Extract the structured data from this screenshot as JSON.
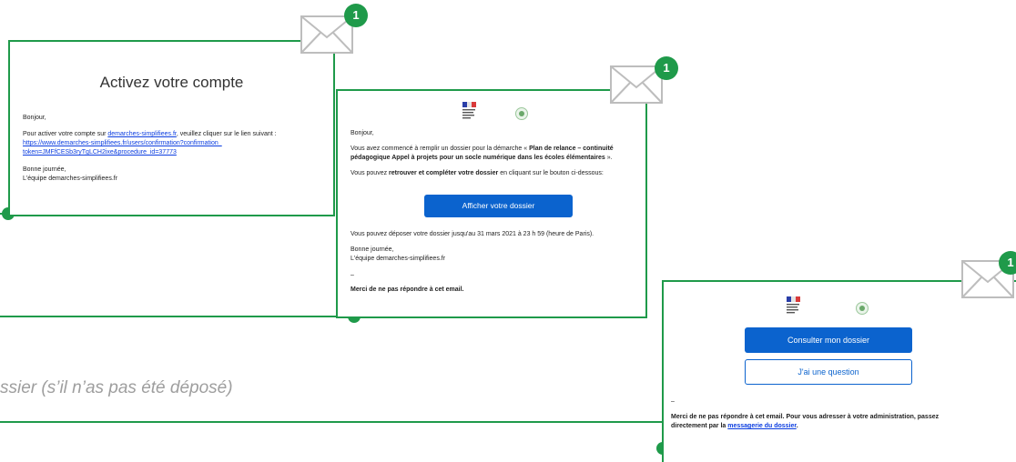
{
  "caption": "ssier (s’il n’as pas été déposé)",
  "colors": {
    "accent": "#1f9a4a",
    "button": "#0b63ce",
    "link": "#0b3de0"
  },
  "email1": {
    "badge": "1",
    "title": "Activez votre compte",
    "greeting": "Bonjour,",
    "body_prefix": "Pour activer votre compte sur ",
    "site_link": "demarches-simplifiees.fr",
    "body_suffix": ", veuillez cliquer sur le lien suivant :",
    "confirm_link_line1": "https://www.demarches-simplifiees.fr/users/confirmation?confirmation_",
    "confirm_link_line2": "token=JMFfCESb3ryTgLCH2ixe&procedure_id=37773",
    "signoff1": "Bonne journée,",
    "signoff2": "L'équipe demarches-simplifiees.fr"
  },
  "email2": {
    "badge": "1",
    "greeting": "Bonjour,",
    "intro_prefix": "Vous avez commencé à remplir un dossier pour la démarche « ",
    "procedure_name": "Plan de relance – continuité pédagogique Appel à projets pour un socle numérique dans les écoles élémentaires",
    "intro_suffix": " ».",
    "cta_prefix": "Vous pouvez ",
    "cta_bold": "retrouver et compléter votre dossier",
    "cta_suffix": " en cliquant sur le bouton ci-dessous:",
    "button_label": "Afficher votre dossier",
    "deadline": "Vous pouvez déposer votre dossier jusqu'au 31 mars 2021 à 23 h 59 (heure de Paris).",
    "signoff1": "Bonne journée,",
    "signoff2": "L'équipe demarches-simplifiees.fr",
    "dash": "–",
    "noreply": "Merci de ne pas répondre à cet email."
  },
  "email3": {
    "badge": "1",
    "button_primary": "Consulter mon dossier",
    "button_secondary": "J'ai une question",
    "dash": "–",
    "noreply_prefix": "Merci de ne pas répondre à cet email. Pour vous adresser à votre administration, passez directement par la ",
    "messagerie_link": "messagerie du dossier",
    "noreply_suffix": "."
  }
}
